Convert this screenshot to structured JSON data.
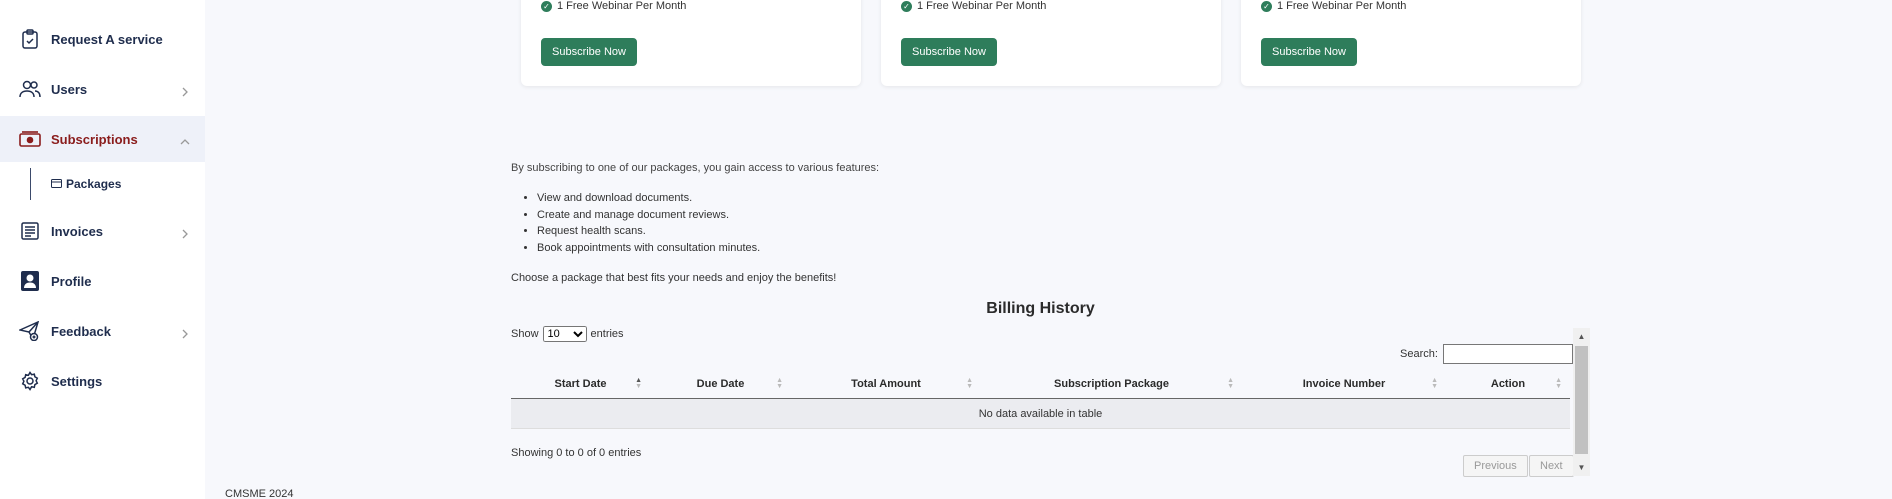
{
  "sidebar": {
    "items": [
      {
        "label": "Request A service",
        "icon": "clipboard-icon"
      },
      {
        "label": "Users",
        "icon": "users-icon"
      },
      {
        "label": "Subscriptions",
        "icon": "money-icon"
      },
      {
        "label": "Invoices",
        "icon": "invoice-icon"
      },
      {
        "label": "Profile",
        "icon": "profile-icon"
      },
      {
        "label": "Feedback",
        "icon": "paper-plane-icon"
      },
      {
        "label": "Settings",
        "icon": "gear-icon"
      }
    ],
    "subitem": {
      "label": "Packages",
      "icon": "card-icon"
    }
  },
  "cards": [
    {
      "feature": "1 Free Webinar Per Month",
      "button": "Subscribe Now"
    },
    {
      "feature": "1 Free Webinar Per Month",
      "button": "Subscribe Now"
    },
    {
      "feature": "1 Free Webinar Per Month",
      "button": "Subscribe Now"
    }
  ],
  "intro": "By subscribing to one of our packages, you gain access to various features:",
  "features": [
    "View and download documents.",
    "Create and manage document reviews.",
    "Request health scans.",
    "Book appointments with consultation minutes."
  ],
  "choose": "Choose a package that best fits your needs and enjoy the benefits!",
  "billing": {
    "title": "Billing History",
    "show_label": "Show",
    "entries_value": "10",
    "entries_label": "entries",
    "search_label": "Search:",
    "columns": [
      "Start Date",
      "Due Date",
      "Total Amount",
      "Subscription Package",
      "Invoice Number",
      "Action"
    ],
    "empty": "No data available in table",
    "info": "Showing 0 to 0 of 0 entries",
    "previous": "Previous",
    "next": "Next"
  },
  "footer": "CMSME 2024",
  "colors": {
    "accent": "#2e7d5b",
    "active": "#8a1c1c",
    "nav": "#1f2d4d"
  }
}
